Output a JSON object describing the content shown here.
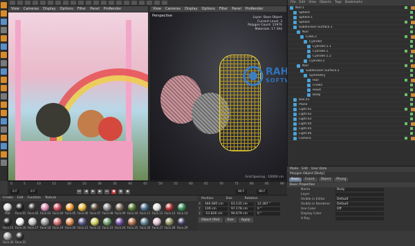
{
  "viewport_left": {
    "menu": [
      "View",
      "Cameras",
      "Display",
      "Options",
      "Filter",
      "Panel",
      "ProRender"
    ]
  },
  "viewport_right": {
    "menu": [
      "View",
      "Cameras",
      "Display",
      "Options",
      "Filter",
      "Panel",
      "ProRender"
    ],
    "label": "Perspective",
    "stats": [
      "Layer",
      "Current Level",
      "Polygon Count",
      "Materials"
    ],
    "stats_vals": [
      "Base Object",
      "3",
      "11976",
      "17 394"
    ],
    "grid": "Grid Spacing : 10000 cm"
  },
  "object_manager": {
    "menu": [
      "File",
      "Edit",
      "View",
      "Objects",
      "Tags",
      "Bookmarks"
    ],
    "rows": [
      "Null.1",
      "Sphere",
      "Sphere.1",
      "Sphere",
      "Subdivision Surface.1",
      "Null",
      "Cube.2",
      "Cylinder",
      "Cylinder.1.1",
      "Cylinder.1",
      "Cylinder.1.2",
      "Cylinder.2",
      "Null",
      "Subdivision Surface.2",
      "Symmetry",
      "Hair",
      "Crown",
      "Head",
      "Body",
      "Box.01",
      "Plane",
      "Light.01",
      "Light.02",
      "Light.03",
      "Light.04",
      "Light.05",
      "Light.06",
      "Camera"
    ]
  },
  "attributes": {
    "menu": [
      "Mode",
      "Edit",
      "User Data"
    ],
    "title": "Polygon Object [Body]",
    "tabs": [
      "Basic",
      "Coord.",
      "Object",
      "Phong"
    ],
    "section": "Basic Properties",
    "rows": [
      {
        "k": "Name",
        "v": "Body"
      },
      {
        "k": "Layer",
        "v": ""
      },
      {
        "k": "Visible in Editor",
        "v": "Default"
      },
      {
        "k": "Visible in Renderer",
        "v": "Default"
      },
      {
        "k": "Use Color",
        "v": "Off"
      },
      {
        "k": "Display Color",
        "v": ""
      },
      {
        "k": "X-Ray",
        "v": ""
      }
    ]
  },
  "timeline": {
    "ticks": [
      "0",
      "5",
      "10",
      "15",
      "20",
      "25",
      "30",
      "35",
      "40",
      "45",
      "50",
      "55",
      "60",
      "65",
      "70",
      "75",
      "80",
      "85",
      "90"
    ],
    "frame_start": "0 F",
    "frame_end": "90 F",
    "fields": [
      "0 F",
      "90 F",
      "90 F"
    ]
  },
  "material": {
    "menu": [
      "Create",
      "Edit",
      "Function",
      "Texture"
    ],
    "items": [
      {
        "name": "Mat",
        "color": "#d9d9d9"
      },
      {
        "name": "Face.01",
        "color": "#222"
      },
      {
        "name": "Face.02",
        "color": "#3b3b3b"
      },
      {
        "name": "Face.03",
        "color": "#d98fb0"
      },
      {
        "name": "Face.04",
        "color": "#c94a5a"
      },
      {
        "name": "Face.05",
        "color": "#f09a30"
      },
      {
        "name": "Face.06",
        "color": "#e7b63a"
      },
      {
        "name": "Face.07",
        "color": "#5c4a3a"
      },
      {
        "name": "Face.08",
        "color": "#8a8a8a"
      },
      {
        "name": "Face.09",
        "color": "#7a6a5a"
      },
      {
        "name": "Face.10",
        "color": "#5a7a3a"
      },
      {
        "name": "Face.11",
        "color": "#4a6f8a"
      },
      {
        "name": "Face.12",
        "color": "#e0e0e0"
      },
      {
        "name": "Face.13",
        "color": "#b03030"
      },
      {
        "name": "Face.14",
        "color": "#3a8a5a"
      },
      {
        "name": "Face.15",
        "color": "#2a2a2a"
      },
      {
        "name": "Face.16",
        "color": "#f5f5f5"
      },
      {
        "name": "Face.17",
        "color": "#c0c0c0"
      },
      {
        "name": "Face.18",
        "color": "#9a9a9a"
      },
      {
        "name": "Face.19",
        "color": "#d07070"
      },
      {
        "name": "Face.20",
        "color": "#e08a50"
      },
      {
        "name": "Face.21",
        "color": "#5a5a8a"
      },
      {
        "name": "Face.22",
        "color": "#d0d060"
      },
      {
        "name": "Face.23",
        "color": "#70a070"
      },
      {
        "name": "Face.24",
        "color": "#7050a0"
      },
      {
        "name": "Face.25",
        "color": "#b07050"
      },
      {
        "name": "Face.26",
        "color": "#608090"
      },
      {
        "name": "Face.27",
        "color": "#e0c0d0"
      },
      {
        "name": "Face.28",
        "color": "#909060"
      },
      {
        "name": "Face.29",
        "color": "#404060"
      },
      {
        "name": "Face.30",
        "color": "#a0a0a0"
      },
      {
        "name": "Face.31",
        "color": "#303030"
      }
    ]
  },
  "coords": {
    "headers": [
      "Position",
      "Size",
      "Rotation"
    ],
    "rows": [
      {
        "axis": "X",
        "pos": "484.685 cm",
        "size": "63.135 cm",
        "rot": "22.387 °"
      },
      {
        "axis": "Y",
        "pos": "109 cm",
        "size": "97.178 cm",
        "rot": "0 °"
      },
      {
        "axis": "Z",
        "pos": "-53.826 cm",
        "size": "90.679 cm",
        "rot": "0 °"
      }
    ],
    "buttons": [
      "Object (Rel)",
      "Size",
      "Apply"
    ]
  },
  "logo": {
    "line1": "RAHIM",
    "line2": "SOFTWARES"
  }
}
